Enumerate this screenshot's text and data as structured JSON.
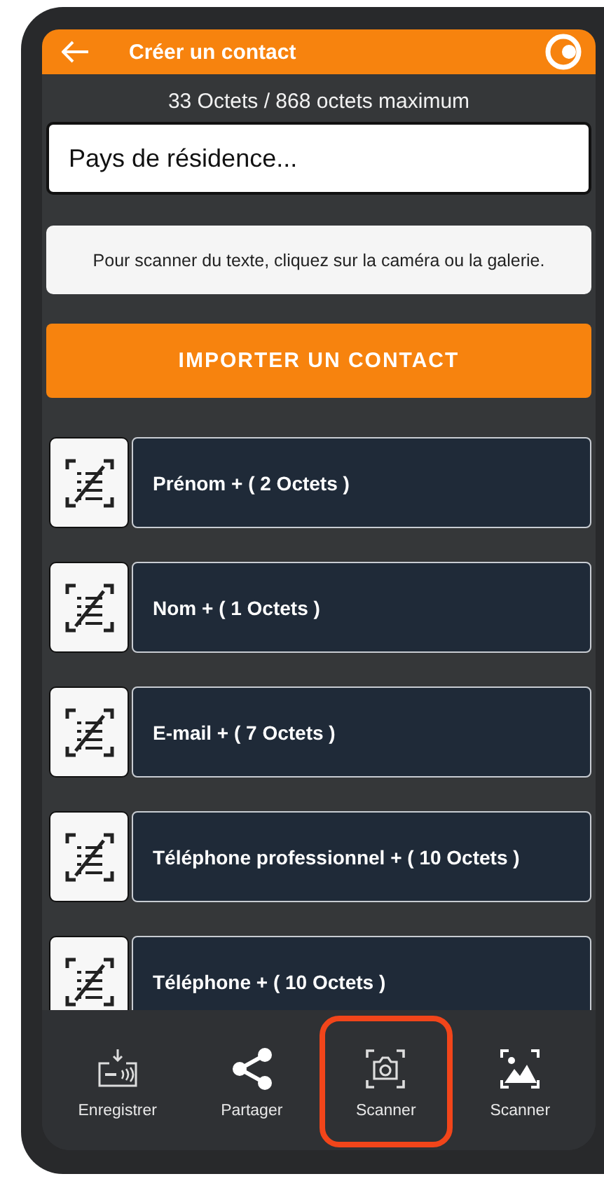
{
  "header": {
    "title": "Créer un contact"
  },
  "byte_count": "33 Octets / 868 octets maximum",
  "country_field": {
    "placeholder": "Pays de résidence..."
  },
  "hint": "Pour scanner du texte, cliquez sur la caméra ou la galerie.",
  "import_button": "IMPORTER UN CONTACT",
  "fields": [
    {
      "label": "Prénom + ( 2 Octets )"
    },
    {
      "label": "Nom + ( 1 Octets )"
    },
    {
      "label": "E-mail + ( 7 Octets )"
    },
    {
      "label": "Téléphone professionnel + ( 10 Octets )"
    },
    {
      "label": "Téléphone  + ( 10 Octets )"
    }
  ],
  "bottom_nav": [
    {
      "kind": "nfc",
      "label": "Enregistrer",
      "selected": false
    },
    {
      "kind": "share",
      "label": "Partager",
      "selected": false
    },
    {
      "kind": "camera",
      "label": "Scanner",
      "selected": true
    },
    {
      "kind": "gallery",
      "label": "Scanner",
      "selected": false
    }
  ]
}
